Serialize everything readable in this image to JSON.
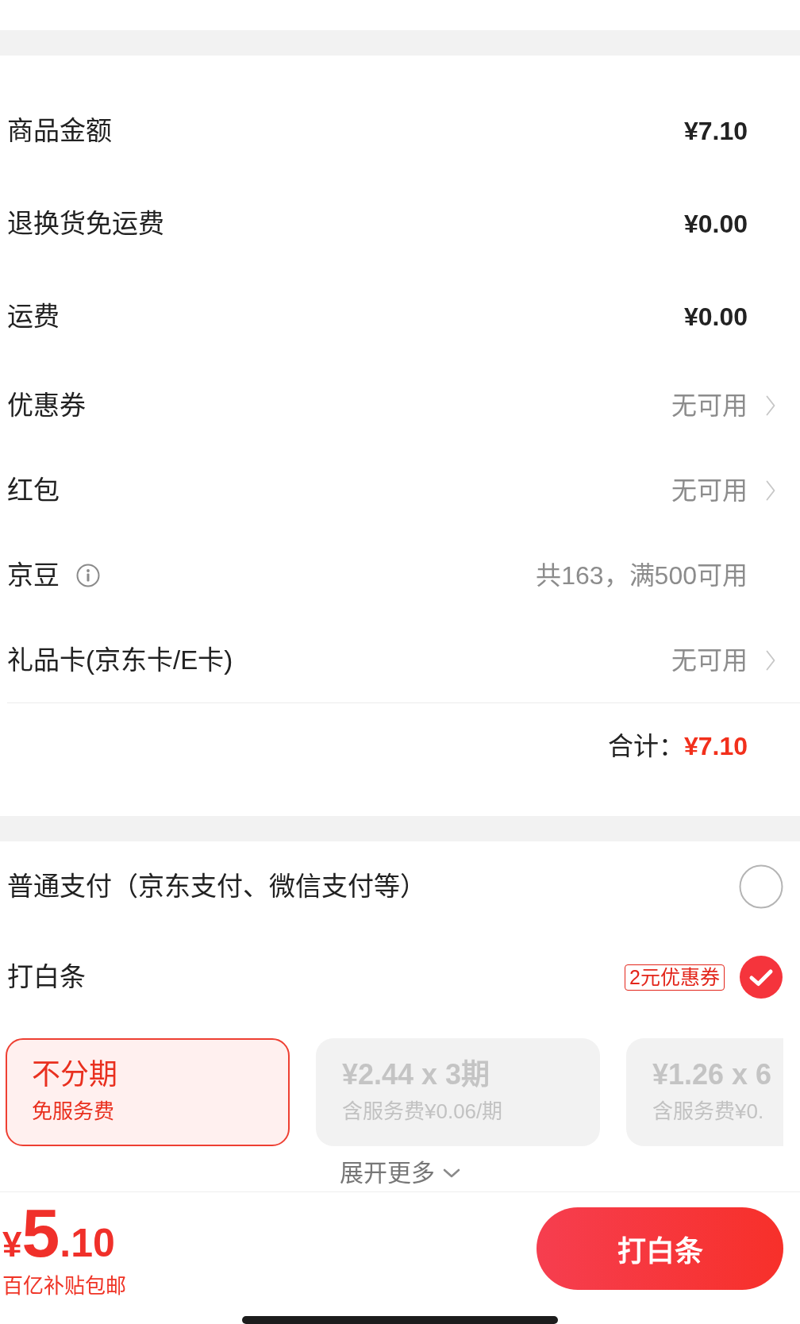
{
  "summary": {
    "rows": [
      {
        "kind": "amount",
        "label": "商品金额",
        "value": "¥7.10"
      },
      {
        "kind": "amount",
        "label": "退换货免运费",
        "value": "¥0.00"
      },
      {
        "kind": "amount",
        "label": "运费",
        "value": "¥0.00"
      },
      {
        "kind": "link",
        "label": "优惠券",
        "value": "无可用"
      },
      {
        "kind": "link",
        "label": "红包",
        "value": "无可用"
      },
      {
        "kind": "info",
        "label": "京豆",
        "value": "共163，满500可用"
      },
      {
        "kind": "link",
        "label": "礼品卡(京东卡/E卡)",
        "value": "无可用"
      }
    ],
    "total": {
      "label": "合计：",
      "value": "¥7.10"
    }
  },
  "payment": {
    "methods": [
      {
        "label": "普通支付（京东支付、微信支付等）",
        "selected": false
      },
      {
        "label": "打白条",
        "badge": "2元优惠券",
        "selected": true
      }
    ],
    "plans": [
      {
        "title": "不分期",
        "note": "免服务费",
        "selected": true
      },
      {
        "title": "¥2.44 x 3期",
        "note": "含服务费¥0.06/期",
        "selected": false
      },
      {
        "title": "¥1.26 x 6",
        "note": "含服务费¥0.",
        "selected": false
      }
    ],
    "expand": "展开更多"
  },
  "bottom_bar": {
    "currency": "¥",
    "price_integer": "5",
    "price_decimal": ".10",
    "subsidy": "百亿补贴包邮",
    "button": "打白条"
  }
}
